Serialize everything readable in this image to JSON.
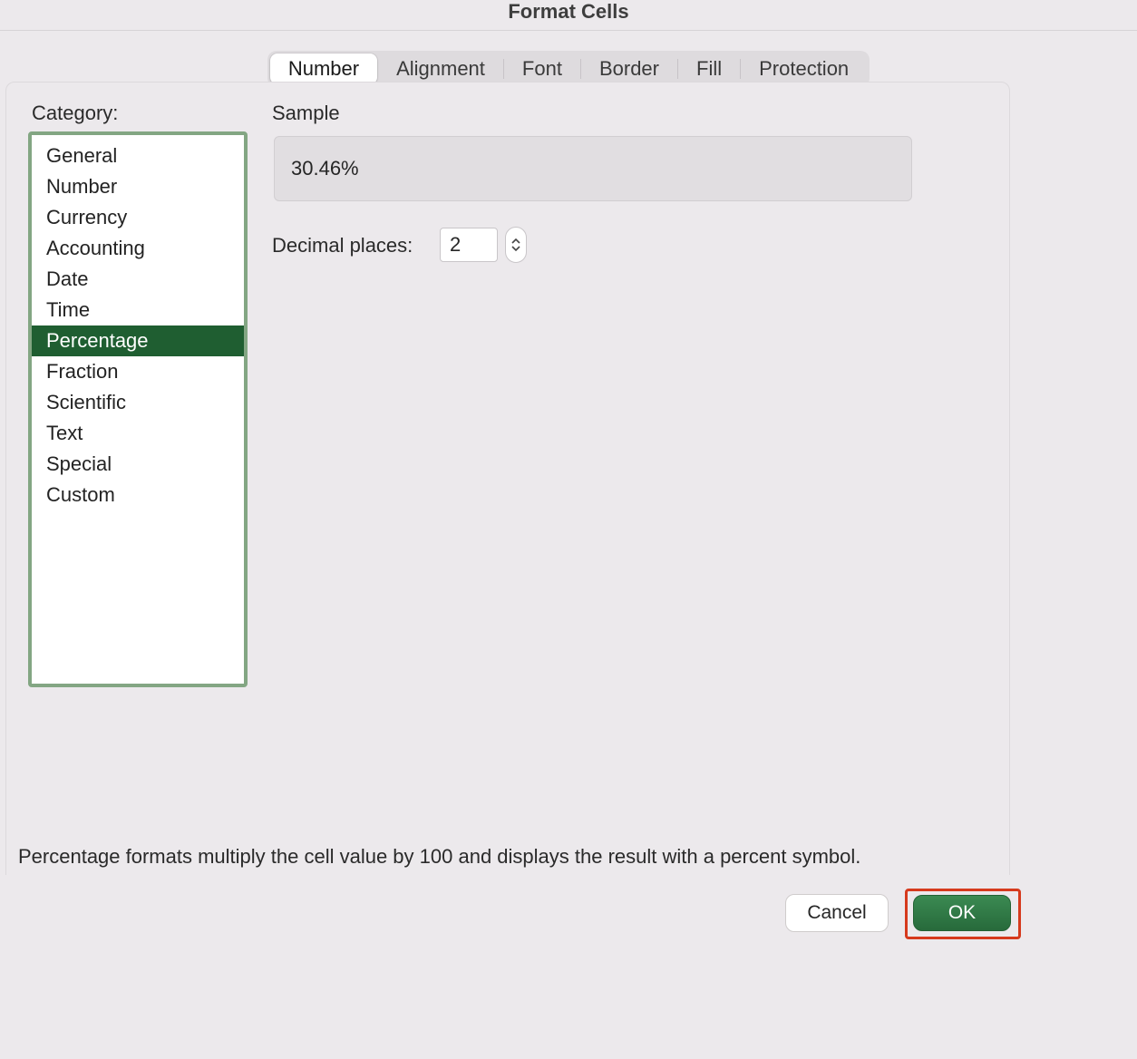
{
  "title": "Format Cells",
  "tabs": {
    "items": [
      "Number",
      "Alignment",
      "Font",
      "Border",
      "Fill",
      "Protection"
    ],
    "active_index": 0
  },
  "category": {
    "label": "Category:",
    "items": [
      "General",
      "Number",
      "Currency",
      "Accounting",
      "Date",
      "Time",
      "Percentage",
      "Fraction",
      "Scientific",
      "Text",
      "Special",
      "Custom"
    ],
    "selected_index": 6
  },
  "sample": {
    "label": "Sample",
    "value": "30.46%"
  },
  "decimal": {
    "label": "Decimal places:",
    "value": "2"
  },
  "description": "Percentage formats multiply the cell value by 100 and displays the result with a percent symbol.",
  "buttons": {
    "cancel": "Cancel",
    "ok": "OK"
  },
  "colors": {
    "accent_green": "#2f7a46",
    "selection_green": "#1f5e31",
    "listbox_border": "#83a683",
    "highlight_red": "#d63a1d"
  }
}
